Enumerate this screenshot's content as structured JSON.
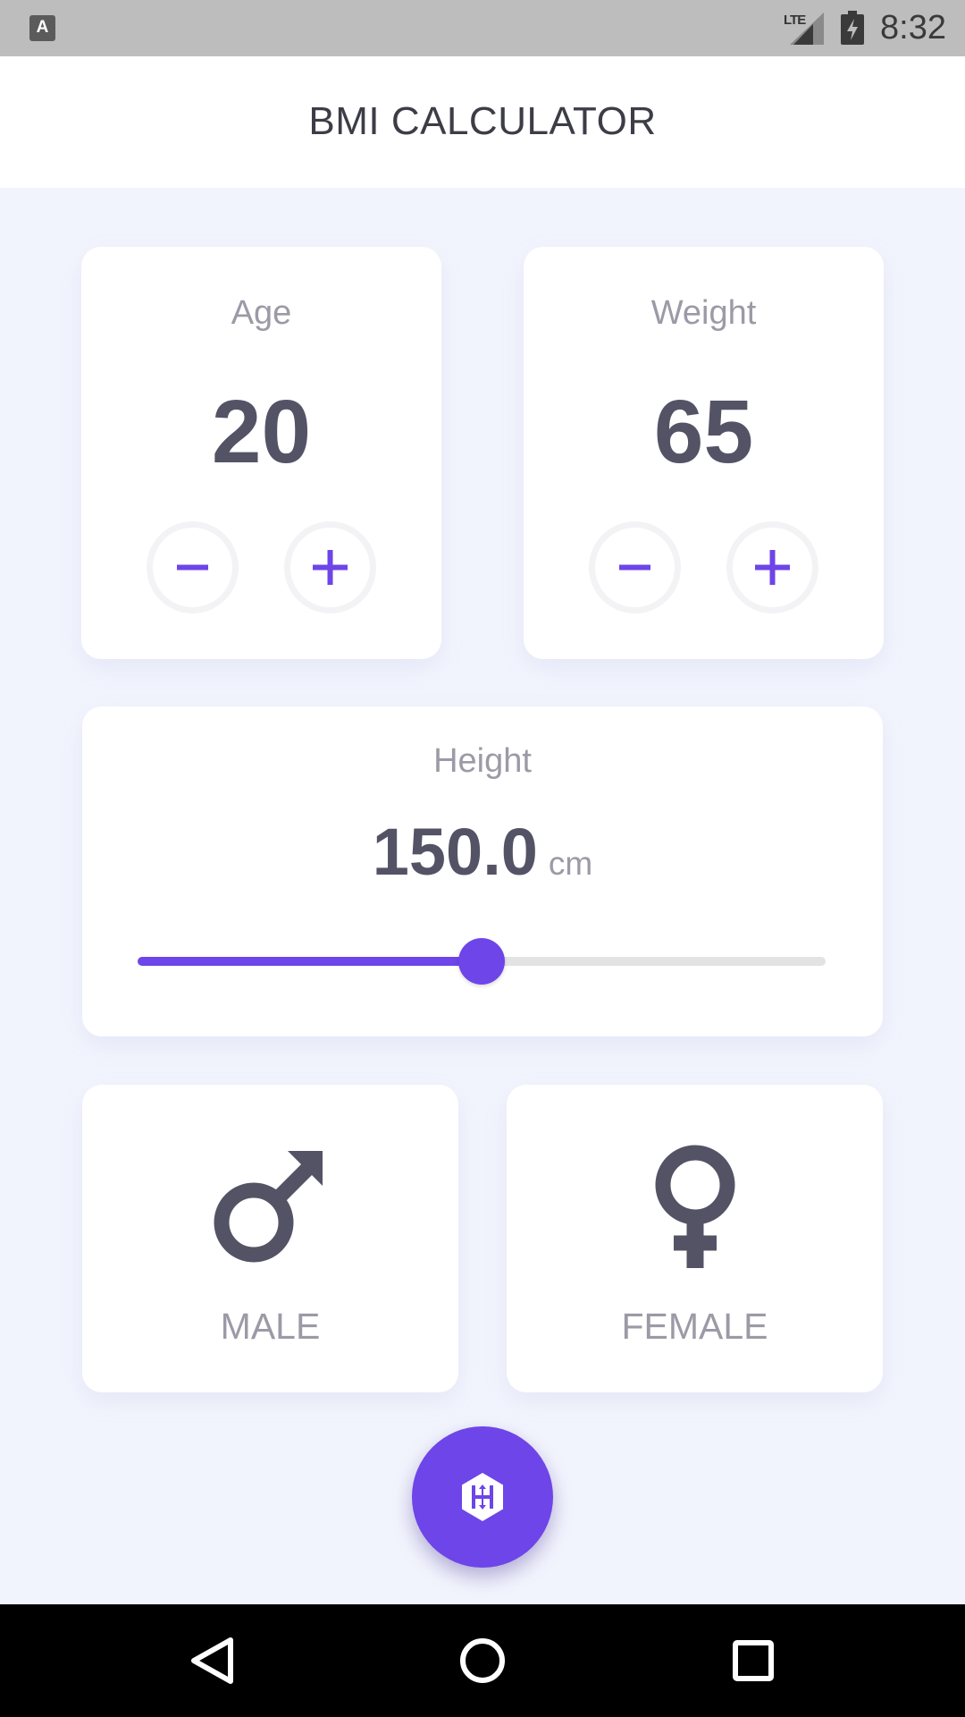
{
  "status_bar": {
    "app_icon": "A",
    "network": "LTE",
    "time": "8:32",
    "icons": [
      "keyboard-notification-icon",
      "signal-icon",
      "battery-charging-icon"
    ]
  },
  "app_bar": {
    "title": "BMI CALCULATOR"
  },
  "age": {
    "label": "Age",
    "value": "20",
    "icons": [
      "minus-icon",
      "plus-icon"
    ]
  },
  "weight": {
    "label": "Weight",
    "value": "65",
    "icons": [
      "minus-icon",
      "plus-icon"
    ]
  },
  "height": {
    "label": "Height",
    "value": "150.0",
    "unit": "cm",
    "slider_fraction": 0.5
  },
  "gender": {
    "male": {
      "label": "MALE",
      "icon": "male-symbol-icon"
    },
    "female": {
      "label": "FEMALE",
      "icon": "female-symbol-icon"
    }
  },
  "fab": {
    "icon": "hexagon-h-icon"
  },
  "nav_bar": {
    "icons": [
      "back-icon",
      "home-icon",
      "recents-icon"
    ]
  },
  "colors": {
    "accent": "#6d45e8",
    "background": "#f2f4fd",
    "card": "#ffffff",
    "value_text": "#545366",
    "label_text": "#9b9aa6"
  }
}
